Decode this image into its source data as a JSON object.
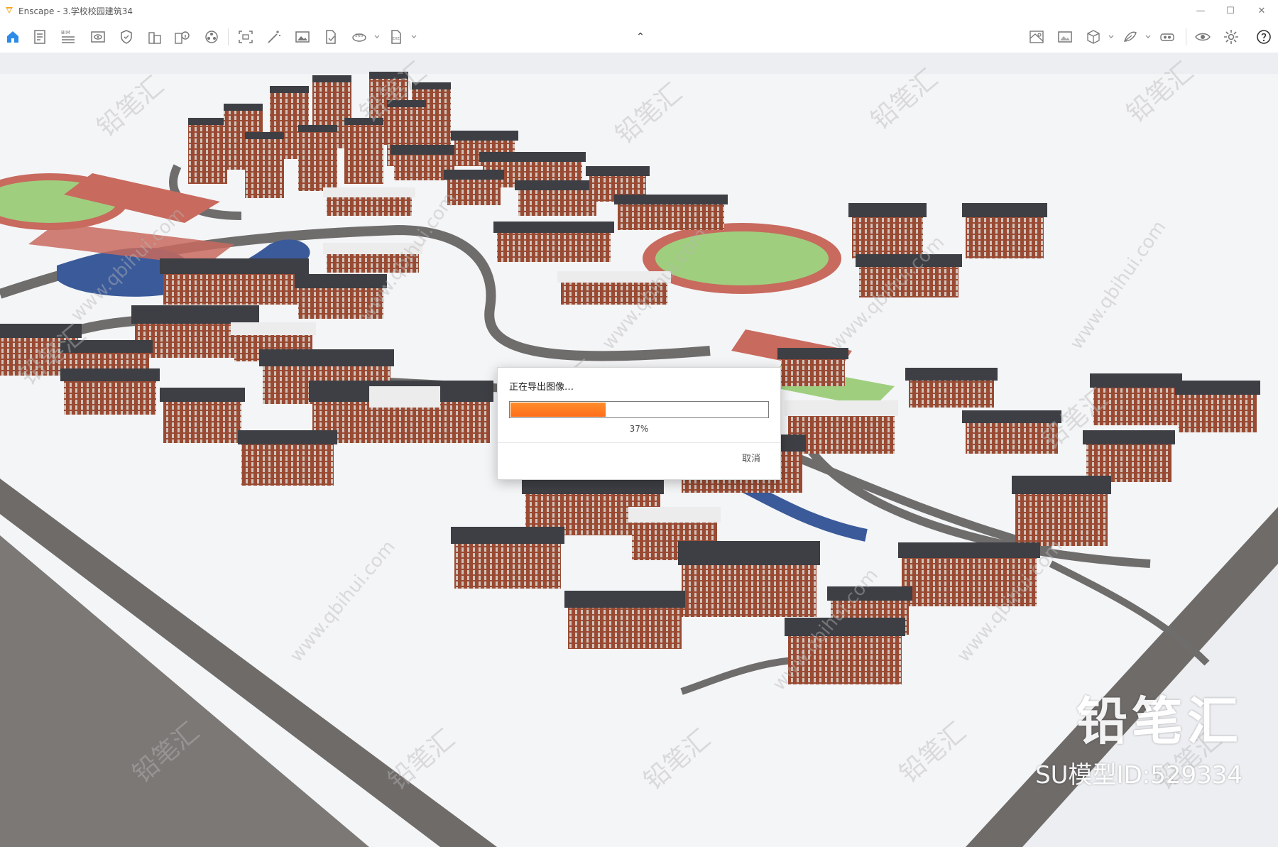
{
  "window": {
    "title": "Enscape - 3.学校校园建筑34",
    "minimize_glyph": "—",
    "maximize_glyph": "☐",
    "close_glyph": "✕"
  },
  "toolbar": {
    "left_icons": [
      "home-icon",
      "document-icon",
      "bim-icon",
      "eye-panel-icon",
      "shield-icon",
      "building-icon",
      "building-info-icon",
      "asset-library-icon",
      "screenshot-icon",
      "wand-icon",
      "image-icon",
      "export-file-icon",
      "panorama-360-icon",
      "exe-export-icon"
    ],
    "bim_label": "BIM",
    "right_icons": [
      "map-icon",
      "gallery-icon",
      "cube-icon",
      "material-icon",
      "vr-headset-icon",
      "visibility-icon",
      "settings-icon",
      "help-icon"
    ],
    "collapse_glyph": "⌃"
  },
  "dialog": {
    "title": "正在导出图像…",
    "progress_value": 0.37,
    "progress_text": "37%",
    "cancel_label": "取消"
  },
  "watermark": {
    "brand": "铅笔汇",
    "model_id": "SU模型ID:529334",
    "tile_text": "铅笔汇",
    "url_text": "www.qbihui.com"
  },
  "colors": {
    "accent_blue": "#2d8ae6",
    "progress_orange": "#ff7a1f",
    "brick": "#9a4a33",
    "roof": "#3d3f44",
    "field_green": "#9fcf7e",
    "track_red": "#c86a5e",
    "water": "#3a5a9a"
  }
}
